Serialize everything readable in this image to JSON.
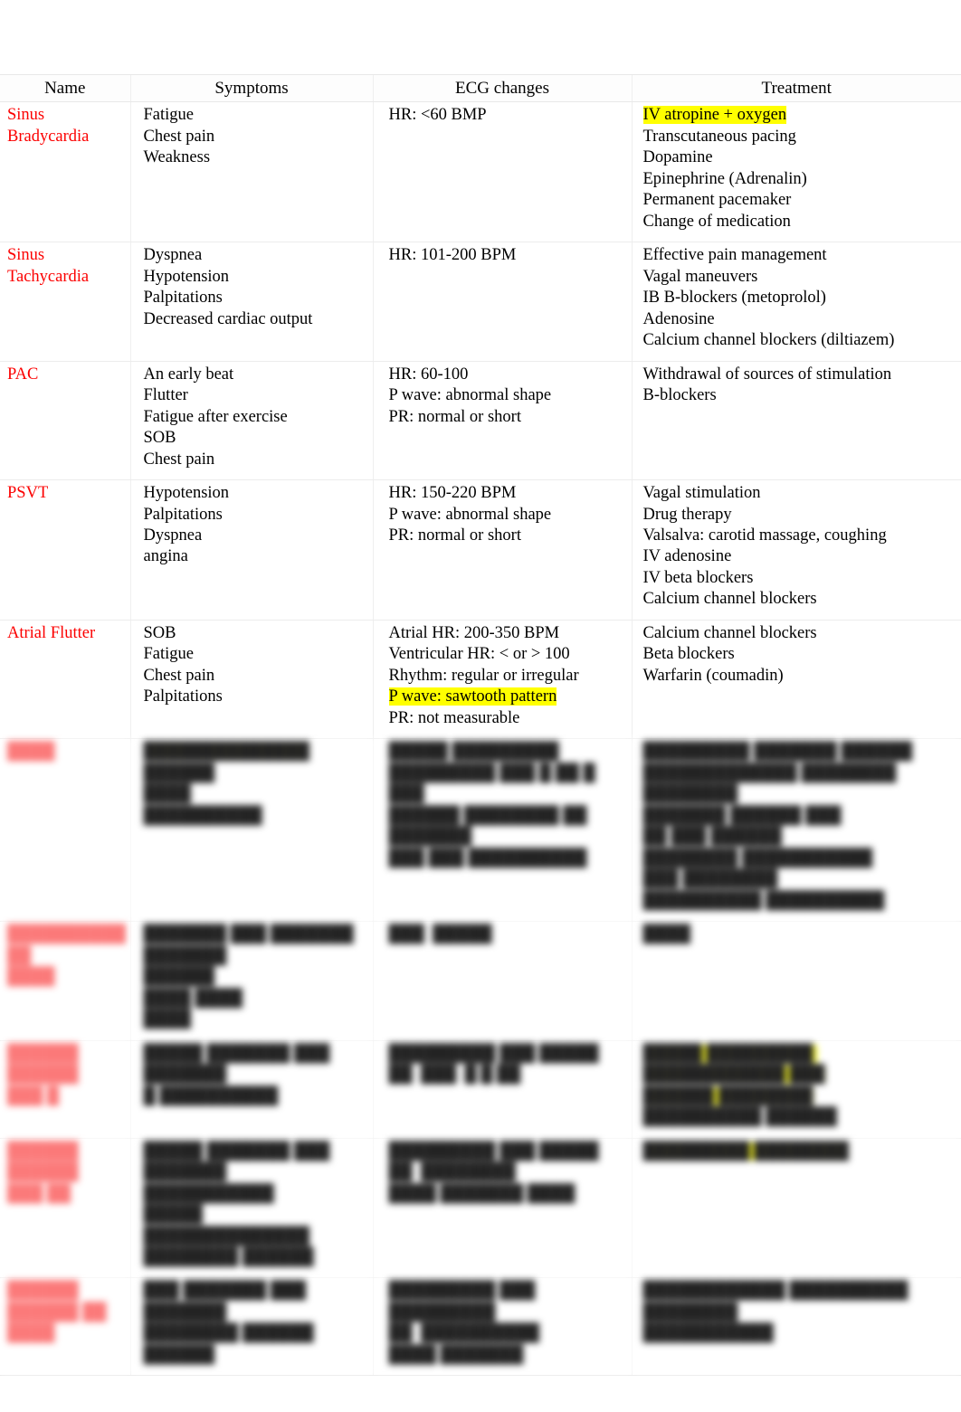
{
  "document": {
    "kind": "cardiac-arrhythmia-reference-table",
    "legible_until_row_index": 4,
    "colors": {
      "row_name_text": "#FC0000",
      "blurred_row_name_text": "#FB6464",
      "highlight": "#FFFF00",
      "page_background": "#FFFFFF",
      "grid_line": "#ECECEC"
    }
  },
  "table": {
    "headers": [
      "Name",
      "Symptoms",
      "ECG changes",
      "Treatment"
    ],
    "rows": [
      {
        "name": [
          "Sinus",
          "Bradycardia"
        ],
        "symptoms": [
          "Fatigue",
          "Chest pain",
          "Weakness"
        ],
        "ecg": [
          "HR: <60 BMP"
        ],
        "treatment": [
          {
            "text": "IV atropine + oxygen",
            "highlight": true
          },
          {
            "text": "Transcutaneous pacing"
          },
          {
            "text": "Dopamine"
          },
          {
            "text": "Epinephrine (Adrenalin)"
          },
          {
            "text": "Permanent pacemaker"
          },
          {
            "text": "Change of medication"
          }
        ],
        "blurred": false
      },
      {
        "name": [
          "Sinus",
          "Tachycardia"
        ],
        "symptoms": [
          "Dyspnea",
          "Hypotension",
          "Palpitations",
          "Decreased cardiac output"
        ],
        "ecg": [
          "HR: 101-200 BPM"
        ],
        "treatment": [
          {
            "text": "Effective pain management"
          },
          {
            "text": "Vagal maneuvers"
          },
          {
            "text": "IB B-blockers (metoprolol)"
          },
          {
            "text": "Adenosine"
          },
          {
            "text": "Calcium channel blockers (diltiazem)"
          }
        ],
        "blurred": false
      },
      {
        "name": [
          "PAC"
        ],
        "symptoms": [
          "An early beat",
          "Flutter",
          "Fatigue after exercise",
          "SOB",
          "Chest pain"
        ],
        "ecg": [
          "HR: 60-100",
          "P wave: abnormal shape",
          "PR: normal or short"
        ],
        "treatment": [
          {
            "text": "Withdrawal of sources of stimulation"
          },
          {
            "text": "B-blockers"
          }
        ],
        "blurred": false
      },
      {
        "name": [
          "PSVT"
        ],
        "symptoms": [
          "Hypotension",
          "Palpitations",
          "Dyspnea",
          "angina"
        ],
        "ecg": [
          "HR: 150-220 BPM",
          "P wave: abnormal shape",
          "PR: normal or short"
        ],
        "treatment": [
          {
            "text": "Vagal stimulation"
          },
          {
            "text": "Drug therapy"
          },
          {
            "text": "Valsalva: carotid massage, coughing"
          },
          {
            "text": "IV adenosine"
          },
          {
            "text": "IV beta blockers"
          },
          {
            "text": "Calcium channel blockers"
          }
        ],
        "blurred": false
      },
      {
        "name": [
          "Atrial Flutter"
        ],
        "symptoms": [
          "SOB",
          "Fatigue",
          "Chest pain",
          "Palpitations"
        ],
        "ecg": [
          "Atrial HR: 200-350 BPM",
          "Ventricular HR: < or > 100",
          "Rhythm: regular or irregular",
          "P wave: sawtooth pattern",
          "PR: not measurable"
        ],
        "ecg_highlight_index": 3,
        "treatment": [
          {
            "text": "Calcium channel blockers"
          },
          {
            "text": "Beta blockers"
          },
          {
            "text": "Warfarin (coumadin)"
          }
        ],
        "blurred": false
      },
      {
        "name": [
          "████"
        ],
        "symptoms": [
          "██████████████",
          "██████",
          "████",
          "██████████"
        ],
        "symptoms_highlight_index": 0,
        "ecg": [
          "█████ █████████",
          "█████████ ███ █ ██ █ ███",
          "██████ ████████ ██ ███████",
          "███ ███ ██████████"
        ],
        "treatment": [
          {
            "text": "█████████ ███████ ██████"
          },
          {
            "text": "█████████████ ████████ ████████"
          },
          {
            "text": "███████ ██████ ███"
          },
          {
            "text": "██ ███ ██████"
          },
          {
            "text": "████████ ███████████"
          },
          {
            "text": "███ ████████"
          },
          {
            "text": "██████████ ██████████"
          }
        ],
        "blurred": true
      },
      {
        "name": [
          "██████████ ██",
          "████"
        ],
        "symptoms": [
          "███████ ███ ███████",
          "███████",
          "██████",
          "████ ████",
          "████"
        ],
        "ecg": [
          "███  █████"
        ],
        "treatment": [
          {
            "text": "████"
          }
        ],
        "blurred": true
      },
      {
        "name": [
          "██████ ██████",
          "███ █"
        ],
        "symptoms": [
          "█████ ███████ ███ ███████",
          "█ ██████████"
        ],
        "ecg": [
          "█████████ ███ █████",
          "██  ███  █ █ ██"
        ],
        "treatment": [
          {
            "text": "█████ █████████ ████████████ ███",
            "highlight": true
          },
          {
            "text": "██████ ████████",
            "highlight": true
          },
          {
            "text": "██████████ ██████"
          }
        ],
        "blurred": true
      },
      {
        "name": [
          "██████ ██████",
          "███ ██"
        ],
        "symptoms": [
          "█████ ███████ ███ ███████",
          "███████████",
          "█████",
          "██████████████",
          "████████ ██████"
        ],
        "ecg": [
          "█████████ ███ █████",
          "██  ████████",
          "████ ███████ ████"
        ],
        "treatment": [
          {
            "text": "█████████ ████████",
            "highlight": true
          }
        ],
        "blurred": true
      },
      {
        "name": [
          "██████ ██████ ██",
          "████"
        ],
        "symptoms": [
          "███ ███████ ███ ███████",
          "████████ ██████",
          "██████"
        ],
        "ecg": [
          "█████████ ███ █████████",
          "██  ██████████",
          "████ ███████"
        ],
        "treatment": [
          {
            "text": "████████████ ██████████"
          },
          {
            "text": "████████"
          },
          {
            "text": "███████████"
          }
        ],
        "blurred": true
      }
    ]
  }
}
